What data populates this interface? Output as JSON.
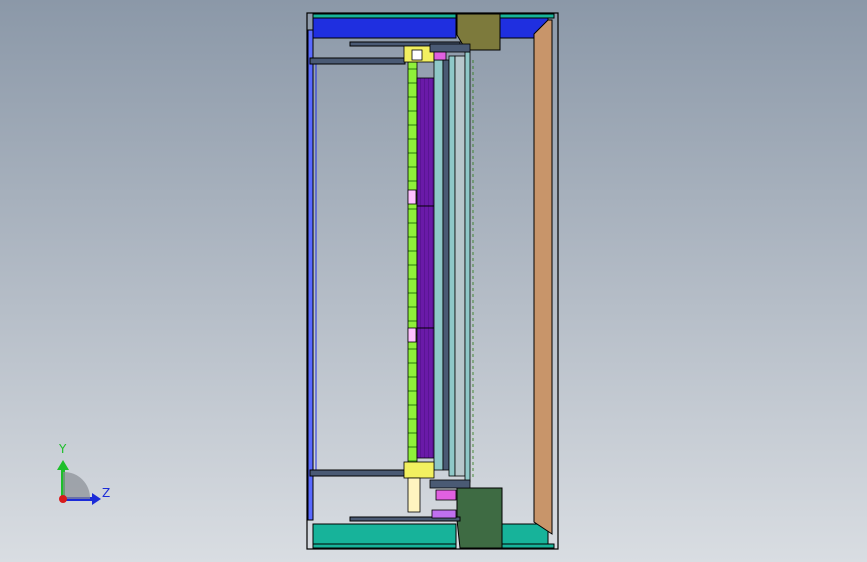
{
  "triad": {
    "y_label": "Y",
    "z_label": "Z"
  },
  "colors": {
    "background_top": "#8b98a8",
    "background_bottom": "#d9dde2",
    "frame_blue": "#1f2fe0",
    "frame_teal": "#17b39a",
    "frame_wood": "#c8956a",
    "frame_line": "#000000",
    "olive_block": "#7d7a3c",
    "dark_green_block": "#3e6b43",
    "purple_panel": "#6a1aa8",
    "lime_rail": "#8ff03a",
    "cyan_bar": "#8fc8c8",
    "slate_bar": "#4a5a74",
    "y_axis": "#1dbf2a",
    "z_axis": "#1b2bd8",
    "origin": "#d81b1b"
  }
}
